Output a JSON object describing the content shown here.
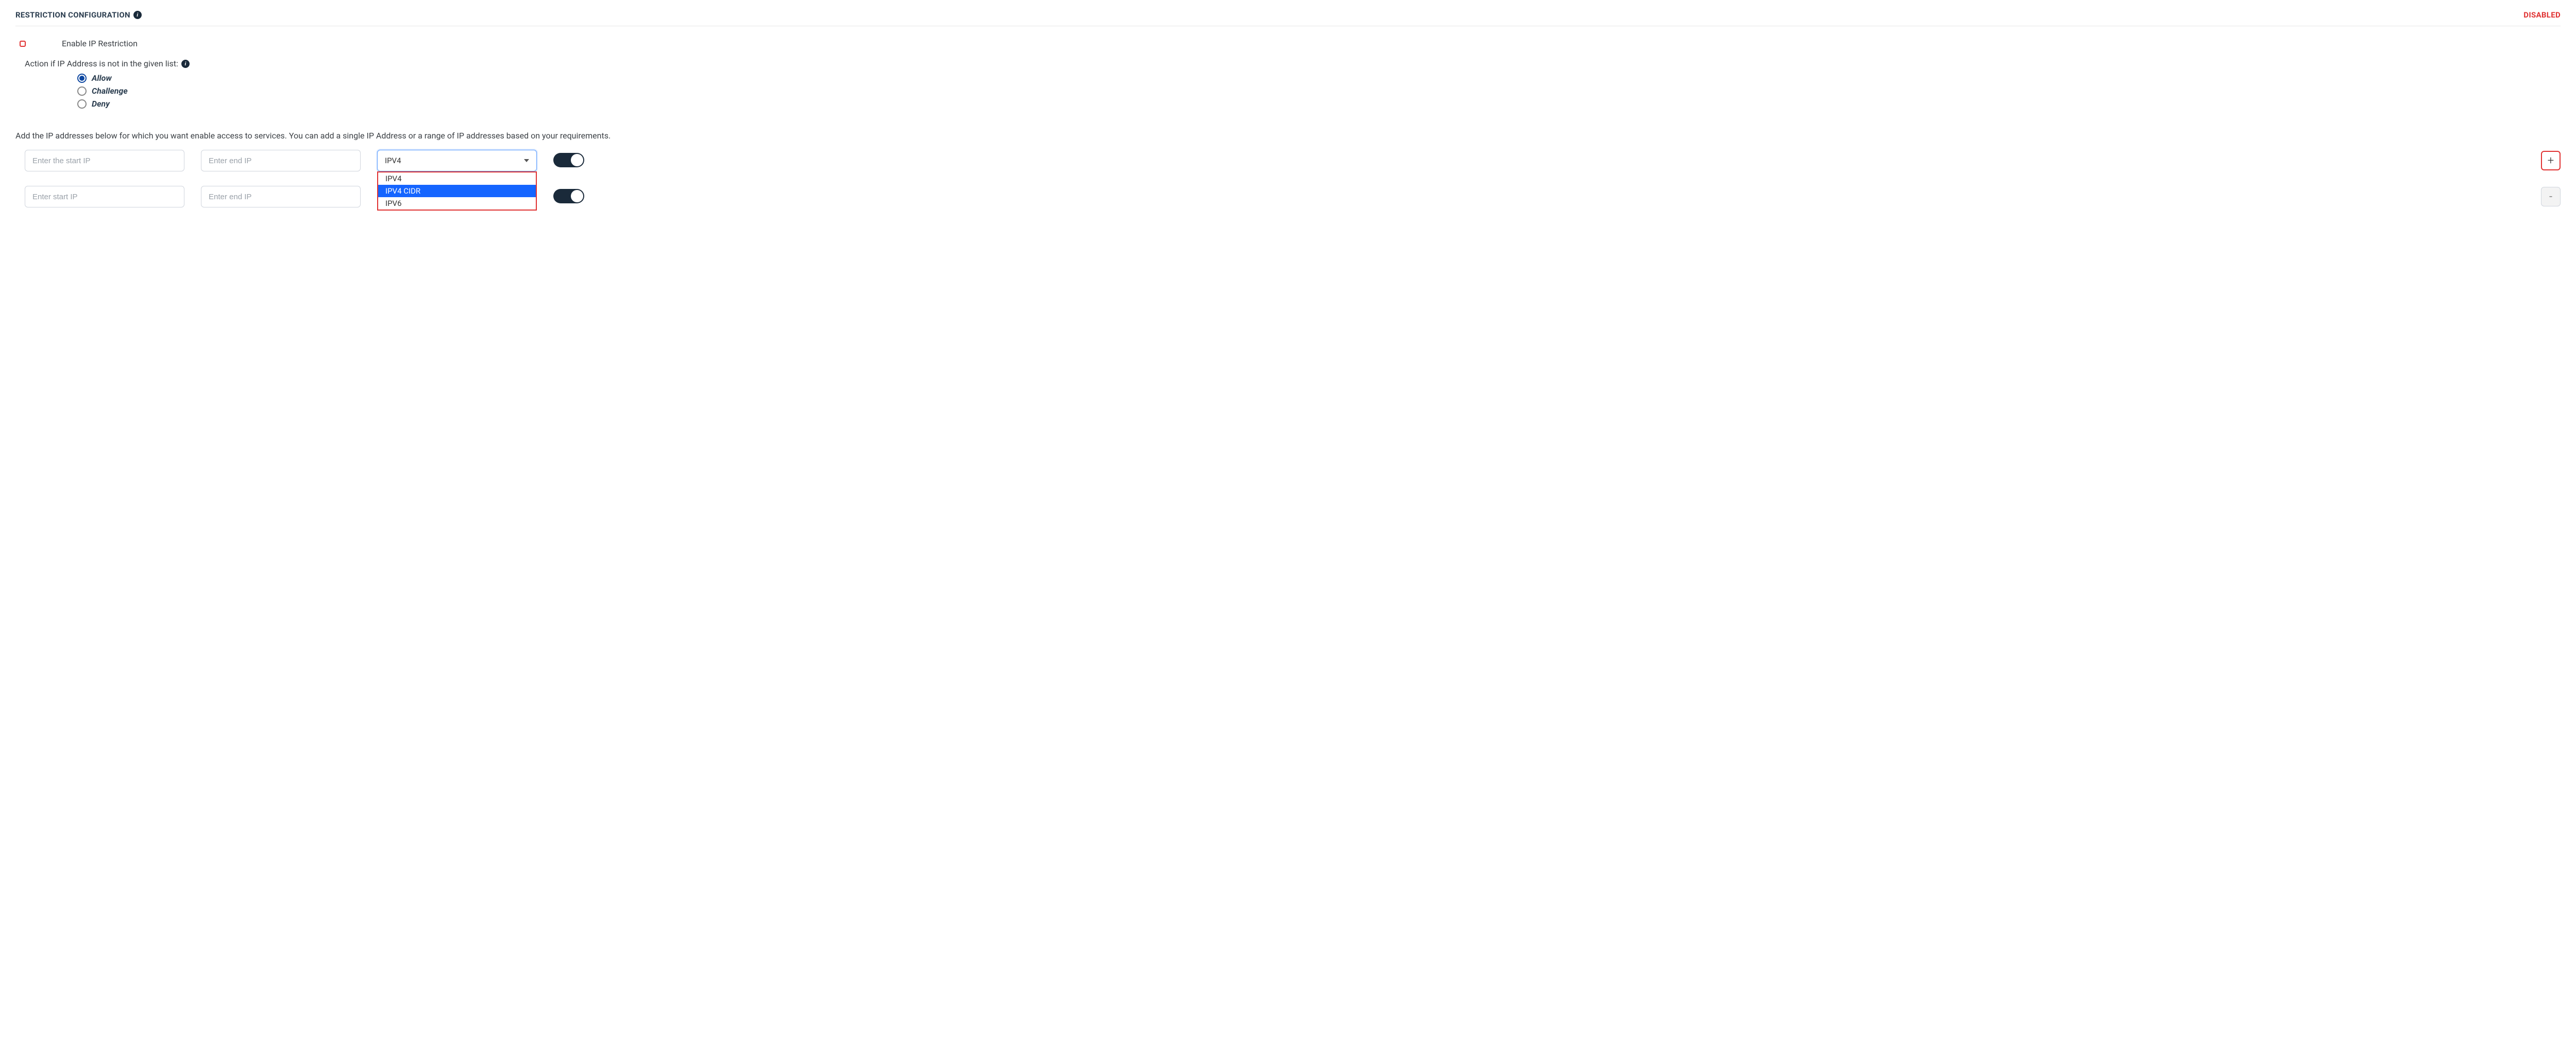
{
  "header": {
    "title": "RESTRICTION CONFIGURATION",
    "status": "DISABLED",
    "info_icon": "i"
  },
  "enable": {
    "label": "Enable IP Restriction"
  },
  "action": {
    "prompt": "Action if IP Address is not in the given list:",
    "info_icon": "i",
    "options": [
      {
        "label": "Allow",
        "selected": true
      },
      {
        "label": "Challenge",
        "selected": false
      },
      {
        "label": "Deny",
        "selected": false
      }
    ]
  },
  "description": "Add the IP addresses below for which you want enable access to services. You can add a single IP Address or a range of IP addresses based on your requirements.",
  "rows": [
    {
      "start_placeholder": "Enter the start IP",
      "start_value": "",
      "end_placeholder": "Enter end IP",
      "end_value": "",
      "select_value": "IPV4",
      "dropdown_open": true,
      "dropdown_items": [
        "IPV4",
        "IPV4 CIDR",
        "IPV6"
      ],
      "dropdown_highlight": "IPV4 CIDR",
      "btn": "+",
      "btn_highlight": true
    },
    {
      "start_placeholder": "Enter start IP",
      "start_value": "",
      "end_placeholder": "Enter end IP",
      "end_value": "",
      "select_value": "",
      "dropdown_open": false,
      "btn": "-",
      "btn_highlight": false
    }
  ]
}
